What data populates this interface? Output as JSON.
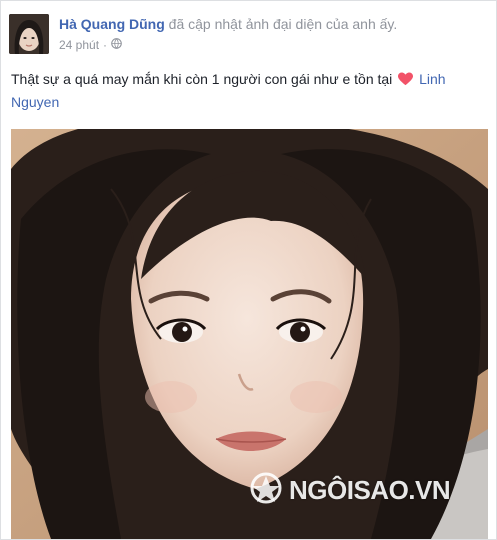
{
  "post": {
    "author": "Hà Quang Dũng",
    "action": " đã cập nhật ảnh đại diện của anh ấy.",
    "time": "24 phút",
    "separator": "·",
    "privacy_icon": "globe-icon",
    "text": "Thật sự a quá may mắn khi còn 1 người con gái như e tồn tại ",
    "heart_icon": "heart-icon",
    "mention": "Linh Nguyen"
  },
  "photo": {
    "watermark": "NGÔISAO.VN",
    "watermark_logo": "ngoisao-logo"
  },
  "colors": {
    "link": "#4267b2",
    "meta": "#90949c",
    "heart": "#f25268"
  }
}
